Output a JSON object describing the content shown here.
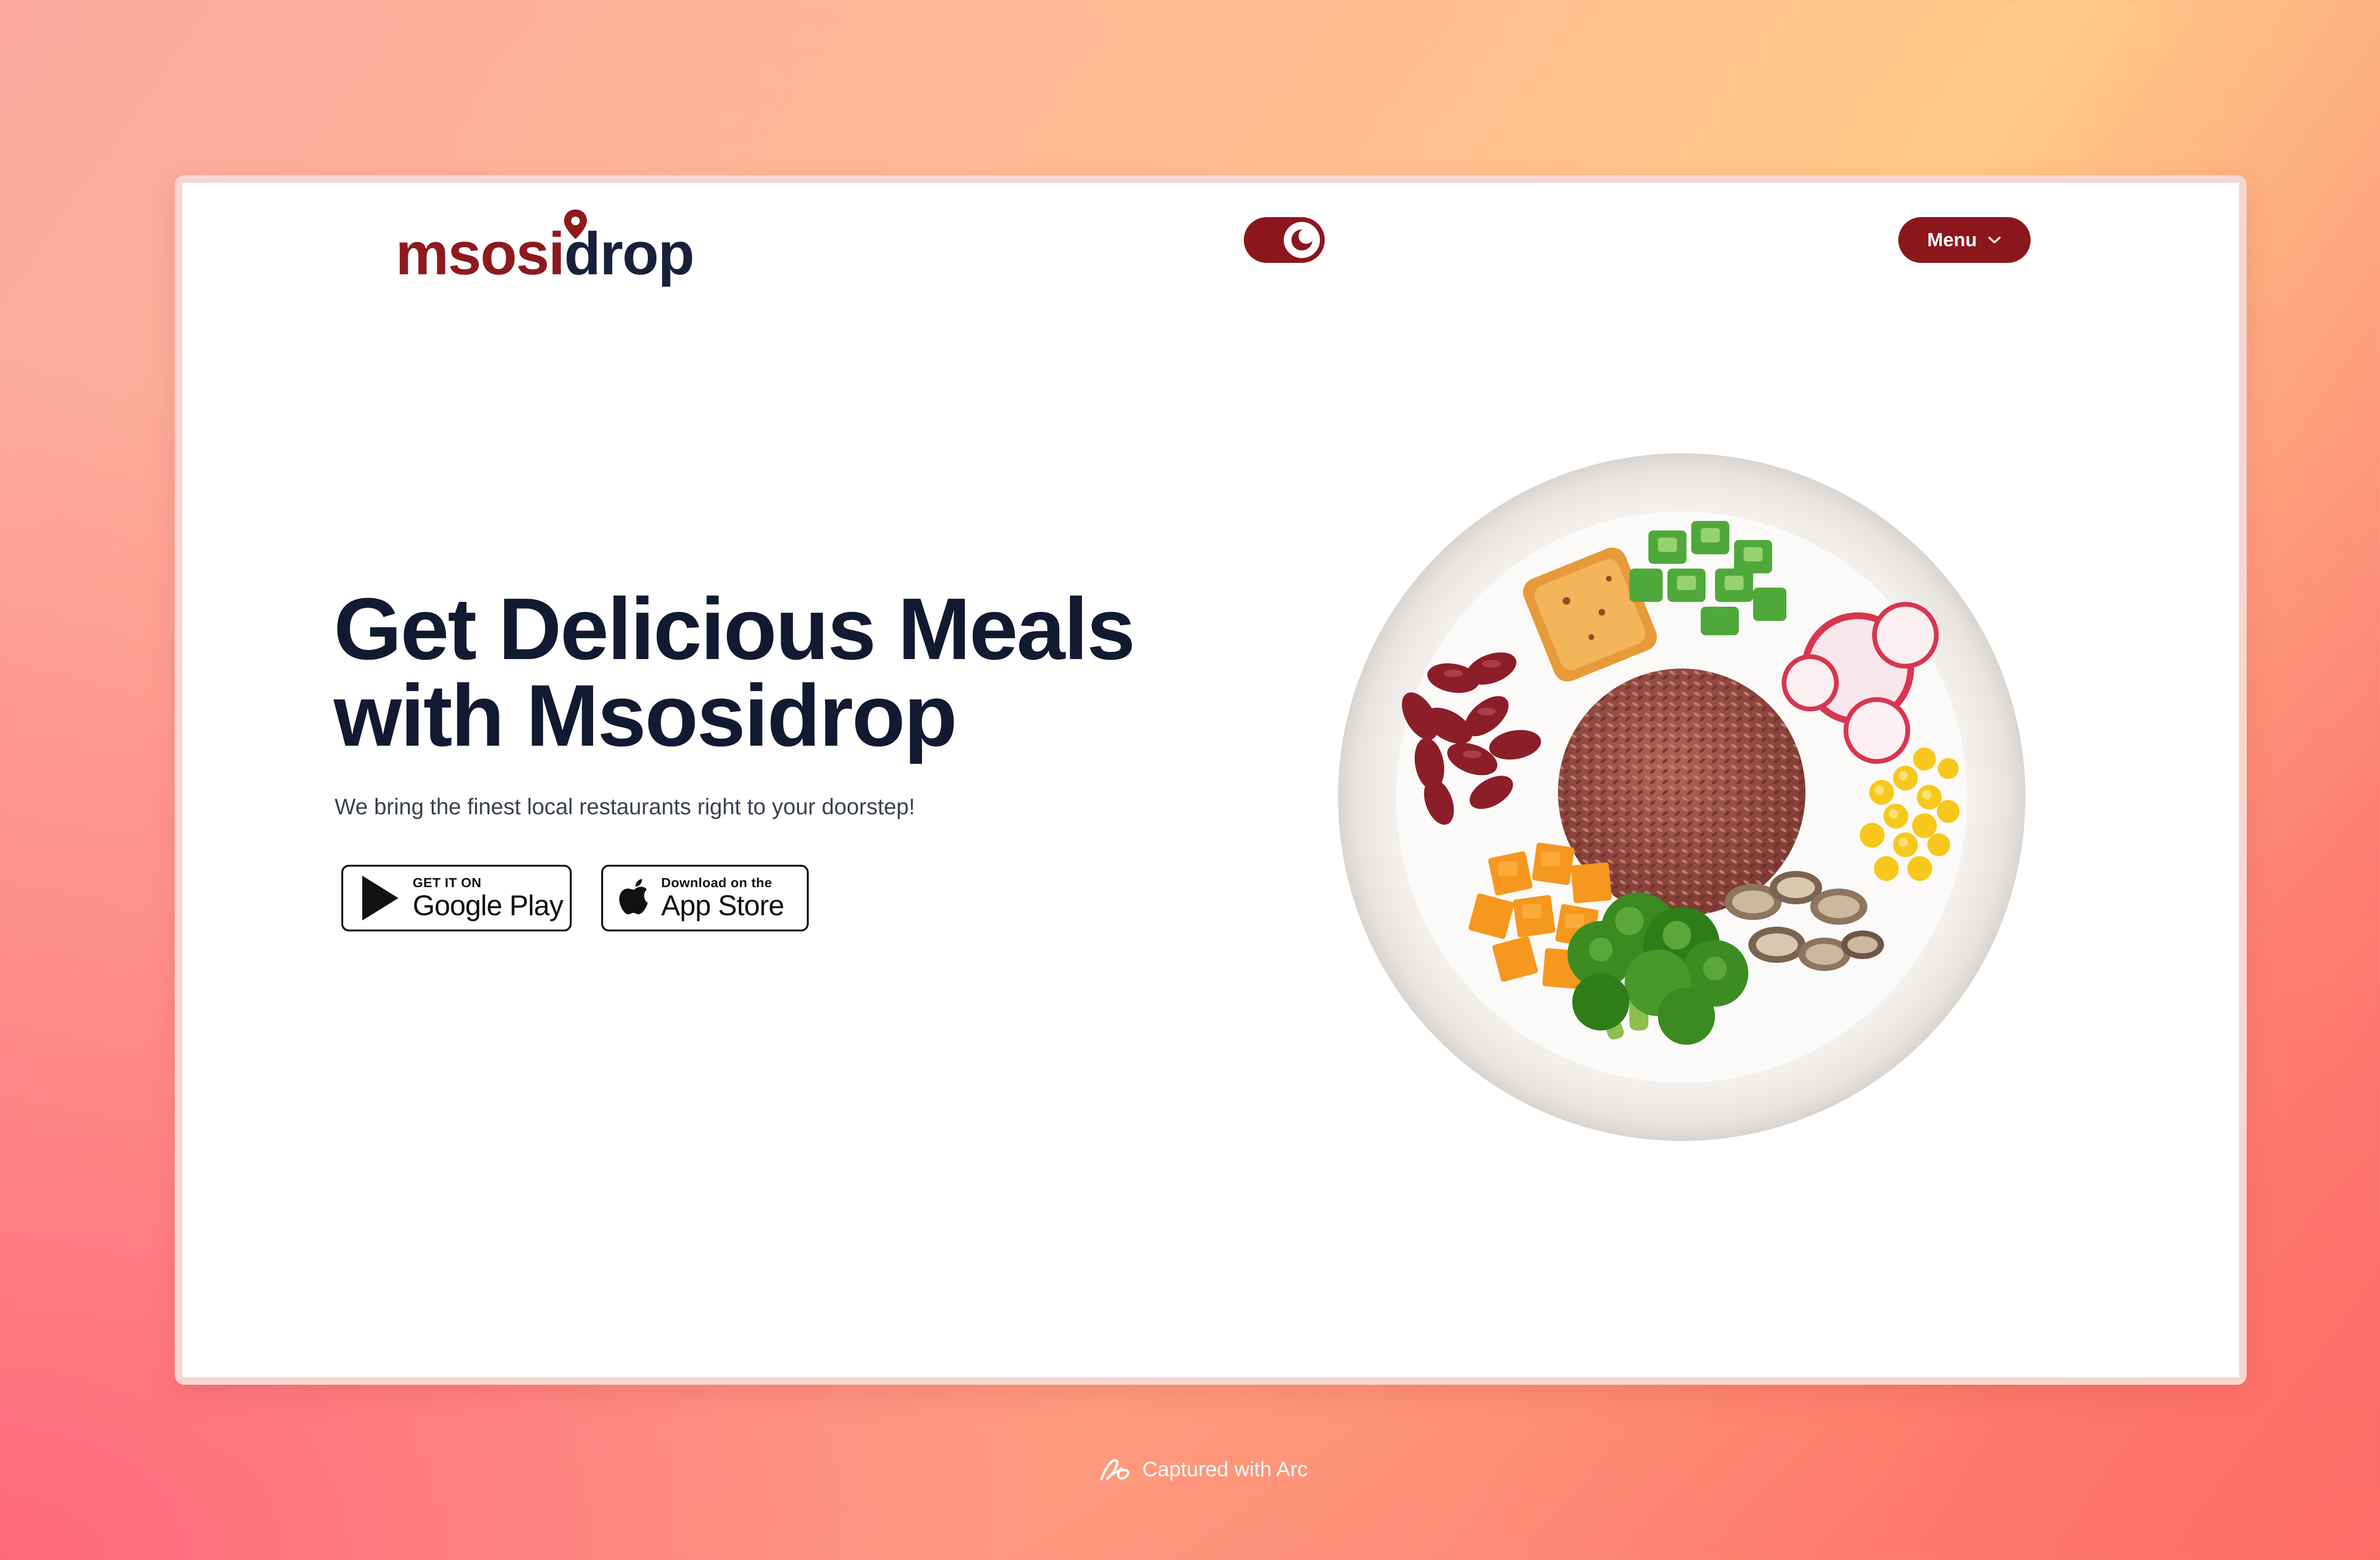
{
  "brand": {
    "logo_part1": "msosi",
    "logo_part2": "drop",
    "primary_color": "#8b171d",
    "dark_color": "#121a31"
  },
  "header": {
    "theme_toggle_icon": "moon-icon",
    "menu_label": "Menu",
    "menu_icon": "chevron-down-icon"
  },
  "hero": {
    "headline_line1": "Get Delicious Meals",
    "headline_line2": "with Msosidrop",
    "subtitle": "We bring the finest local restaurants right to your doorstep!",
    "google_play": {
      "small": "GET IT ON",
      "big": "Google Play"
    },
    "app_store": {
      "small": "Download on the",
      "big": "App Store"
    }
  },
  "footer": {
    "caption": "Captured with Arc",
    "caption_icon": "arc-icon"
  }
}
